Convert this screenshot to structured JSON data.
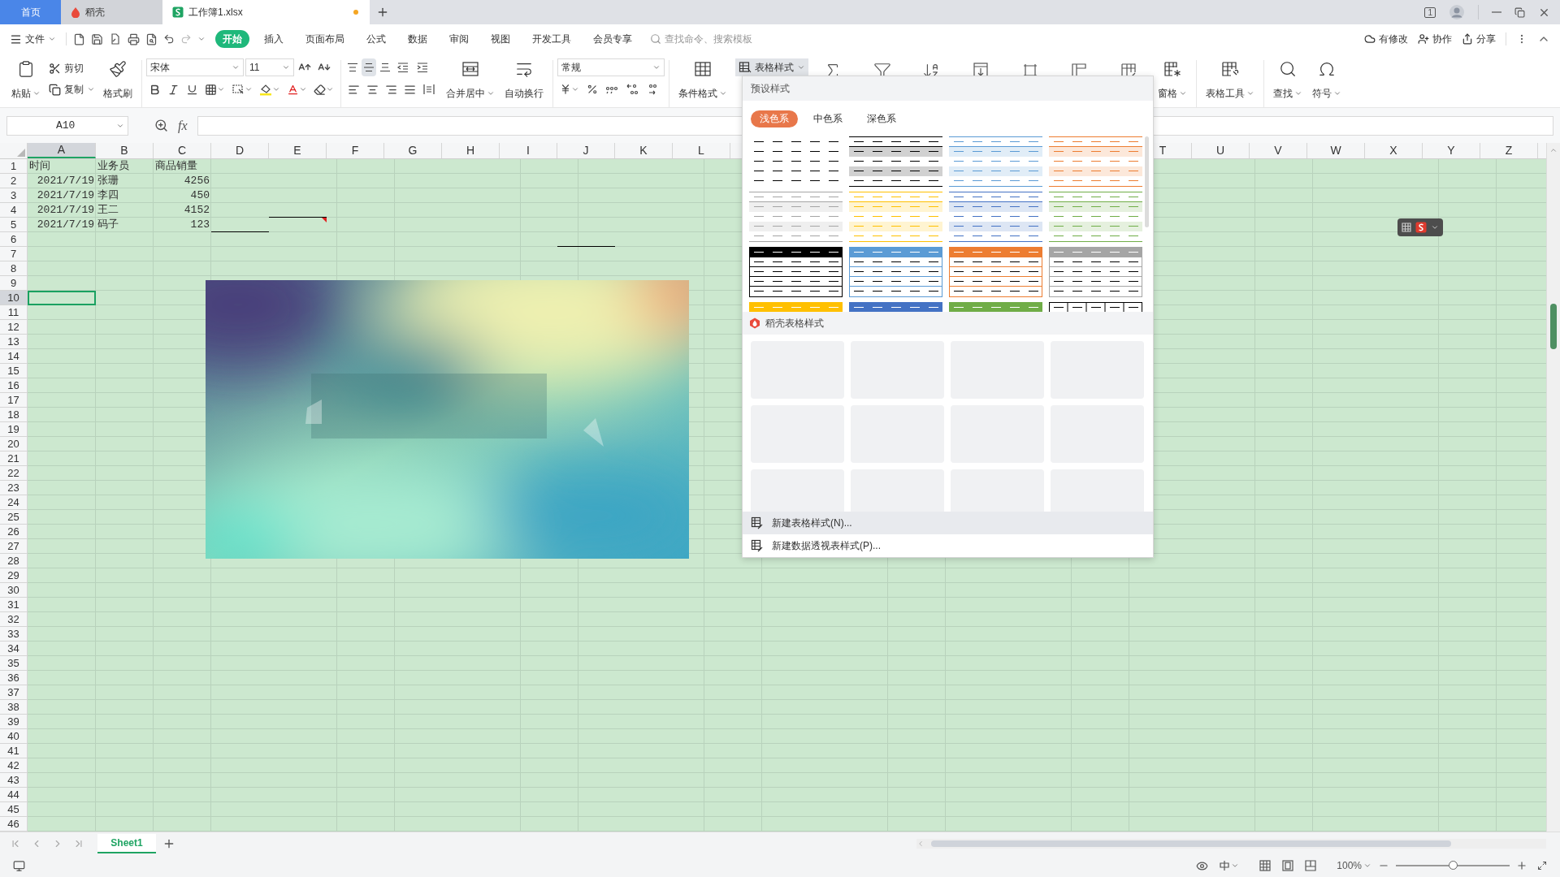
{
  "tabs": [
    {
      "label": "首页",
      "kind": "home",
      "selected": false,
      "modified": false
    },
    {
      "label": "稻壳",
      "kind": "docer",
      "selected": false,
      "modified": false
    },
    {
      "label": "工作簿1.xlsx",
      "kind": "sheet",
      "selected": true,
      "modified": true
    }
  ],
  "topbar": {
    "window_count": "1"
  },
  "menu": {
    "file": "文件",
    "items": [
      {
        "label": "开始",
        "selected": true
      },
      {
        "label": "插入",
        "selected": false
      },
      {
        "label": "页面布局",
        "selected": false
      },
      {
        "label": "公式",
        "selected": false
      },
      {
        "label": "数据",
        "selected": false
      },
      {
        "label": "审阅",
        "selected": false
      },
      {
        "label": "视图",
        "selected": false
      },
      {
        "label": "开发工具",
        "selected": false
      },
      {
        "label": "会员专享",
        "selected": false
      }
    ],
    "search": {
      "placeholder": "查找命令、搜索模板"
    },
    "actions": [
      {
        "label": "有修改",
        "kind": "cloud"
      },
      {
        "label": "协作",
        "kind": "collab"
      },
      {
        "label": "分享",
        "kind": "share"
      }
    ]
  },
  "ribbon": {
    "paste": "粘贴",
    "cut": "剪切",
    "copy": "复制",
    "format_painter": "格式刷",
    "font": "宋体",
    "font_size": "11",
    "vertical_align": [
      {
        "kind": "top",
        "selected": false
      },
      {
        "kind": "middle",
        "selected": true
      },
      {
        "kind": "bottom",
        "selected": false
      }
    ],
    "merge": "合并居中",
    "wrap": "自动换行",
    "number_format": "常规",
    "conditional": "条件格式",
    "table_style": {
      "label": "表格样式",
      "expanded": true
    },
    "freeze": "窗格",
    "table_tools": "表格工具",
    "find": "查找",
    "symbol": "符号"
  },
  "formula_bar": {
    "name_box": "A10",
    "fx": "fx"
  },
  "sheet": {
    "columns_left": [
      {
        "label": "A",
        "selected": true
      },
      {
        "label": "B",
        "selected": false
      },
      {
        "label": "C",
        "selected": false
      },
      {
        "label": "D",
        "selected": false
      },
      {
        "label": "E",
        "selected": false
      },
      {
        "label": "F",
        "selected": false
      },
      {
        "label": "G",
        "selected": false
      },
      {
        "label": "H",
        "selected": false
      },
      {
        "label": "I",
        "selected": false
      },
      {
        "label": "J",
        "selected": false
      },
      {
        "label": "K",
        "selected": false
      },
      {
        "label": "L",
        "selected": false
      }
    ],
    "columns_right": [
      {
        "label": "T",
        "selected": false
      },
      {
        "label": "U",
        "selected": false
      },
      {
        "label": "V",
        "selected": false
      },
      {
        "label": "W",
        "selected": false
      },
      {
        "label": "X",
        "selected": false
      },
      {
        "label": "Y",
        "selected": false
      },
      {
        "label": "Z",
        "selected": false
      }
    ],
    "rows": [
      {
        "number": "1",
        "selected": false,
        "cells": [
          {
            "text": "时间",
            "kind": "text"
          },
          {
            "text": "业务员",
            "kind": "text"
          },
          {
            "text": "商品销量",
            "kind": "text"
          }
        ]
      },
      {
        "number": "2",
        "selected": false,
        "cells": [
          {
            "text": "2021/7/19",
            "kind": "number"
          },
          {
            "text": "张珊",
            "kind": "text"
          },
          {
            "text": "4256",
            "kind": "number"
          }
        ]
      },
      {
        "number": "3",
        "selected": false,
        "cells": [
          {
            "text": "2021/7/19",
            "kind": "number"
          },
          {
            "text": "李四",
            "kind": "text"
          },
          {
            "text": "450",
            "kind": "number"
          }
        ]
      },
      {
        "number": "4",
        "selected": false,
        "cells": [
          {
            "text": "2021/7/19",
            "kind": "number"
          },
          {
            "text": "王二",
            "kind": "text"
          },
          {
            "text": "4152",
            "kind": "number"
          },
          {
            "kind": "empty"
          },
          {
            "kind": "bottom-border"
          }
        ]
      },
      {
        "number": "5",
        "selected": false,
        "cells": [
          {
            "text": "2021/7/19",
            "kind": "number"
          },
          {
            "text": "码子",
            "kind": "text"
          },
          {
            "text": "123",
            "kind": "number"
          },
          {
            "kind": "bottom-border"
          },
          {
            "kind": "comment"
          }
        ]
      },
      {
        "number": "6",
        "selected": false,
        "cells": [
          {
            "kind": "empty"
          },
          {
            "kind": "empty"
          },
          {
            "kind": "empty"
          },
          {
            "kind": "empty"
          },
          {
            "kind": "empty"
          },
          {
            "kind": "empty"
          },
          {
            "kind": "empty"
          },
          {
            "kind": "empty"
          },
          {
            "kind": "empty"
          },
          {
            "kind": "bottom-border"
          }
        ]
      },
      {
        "number": "7",
        "selected": false
      },
      {
        "number": "8",
        "selected": false
      },
      {
        "number": "9",
        "selected": false
      },
      {
        "number": "10",
        "selected": true
      },
      {
        "number": "11",
        "selected": false
      },
      {
        "number": "12",
        "selected": false
      },
      {
        "number": "13",
        "selected": false
      },
      {
        "number": "14",
        "selected": false
      },
      {
        "number": "15",
        "selected": false
      },
      {
        "number": "16",
        "selected": false
      },
      {
        "number": "17",
        "selected": false
      },
      {
        "number": "18",
        "selected": false
      },
      {
        "number": "19",
        "selected": false
      },
      {
        "number": "20",
        "selected": false
      },
      {
        "number": "21",
        "selected": false
      },
      {
        "number": "22",
        "selected": false
      },
      {
        "number": "23",
        "selected": false
      },
      {
        "number": "24",
        "selected": false
      },
      {
        "number": "25",
        "selected": false
      },
      {
        "number": "26",
        "selected": false
      },
      {
        "number": "27",
        "selected": false
      },
      {
        "number": "28",
        "selected": false
      },
      {
        "number": "29",
        "selected": false
      },
      {
        "number": "30",
        "selected": false
      },
      {
        "number": "31",
        "selected": false
      },
      {
        "number": "32",
        "selected": false
      },
      {
        "number": "33",
        "selected": false
      },
      {
        "number": "34",
        "selected": false
      },
      {
        "number": "35",
        "selected": false
      },
      {
        "number": "36",
        "selected": false
      },
      {
        "number": "37",
        "selected": false
      },
      {
        "number": "38",
        "selected": false
      },
      {
        "number": "39",
        "selected": false
      },
      {
        "number": "40",
        "selected": false
      },
      {
        "number": "41",
        "selected": false
      },
      {
        "number": "42",
        "selected": false
      },
      {
        "number": "43",
        "selected": false
      },
      {
        "number": "44",
        "selected": false
      },
      {
        "number": "45",
        "selected": false
      },
      {
        "number": "46",
        "selected": false
      }
    ]
  },
  "style_menu": {
    "title": "预设样式",
    "tabs": [
      {
        "label": "浅色系",
        "selected": true
      },
      {
        "label": "中色系",
        "selected": false
      },
      {
        "label": "深色系",
        "selected": false
      }
    ],
    "styles": [
      {
        "kind": "plain",
        "color": "#000000"
      },
      {
        "kind": "banded",
        "color": "#000000"
      },
      {
        "kind": "banded",
        "color": "#5b9bd5"
      },
      {
        "kind": "banded",
        "color": "#ed7d31"
      },
      {
        "kind": "banded",
        "color": "#a5a5a5"
      },
      {
        "kind": "banded",
        "color": "#ffc000"
      },
      {
        "kind": "banded",
        "color": "#4472c4"
      },
      {
        "kind": "banded",
        "color": "#70ad47"
      },
      {
        "kind": "grid",
        "color": "#000000"
      },
      {
        "kind": "grid",
        "color": "#5b9bd5"
      },
      {
        "kind": "grid",
        "color": "#ed7d31"
      },
      {
        "kind": "grid",
        "color": "#a5a5a5"
      },
      {
        "kind": "grid",
        "color": "#ffc000"
      },
      {
        "kind": "grid",
        "color": "#4472c4"
      },
      {
        "kind": "grid",
        "color": "#70ad47"
      },
      {
        "kind": "open-grid",
        "color": "#000000"
      }
    ],
    "docer_title": "稻壳表格样式",
    "actions": [
      {
        "label": "新建表格样式(N)...",
        "selected": true
      },
      {
        "label": "新建数据透视表样式(P)...",
        "selected": false
      }
    ]
  },
  "sheet_tabs": [
    {
      "label": "Sheet1",
      "selected": true
    }
  ],
  "status_bar": {
    "zoom": "100%",
    "zoom_slider": {
      "level": 0.5
    }
  }
}
